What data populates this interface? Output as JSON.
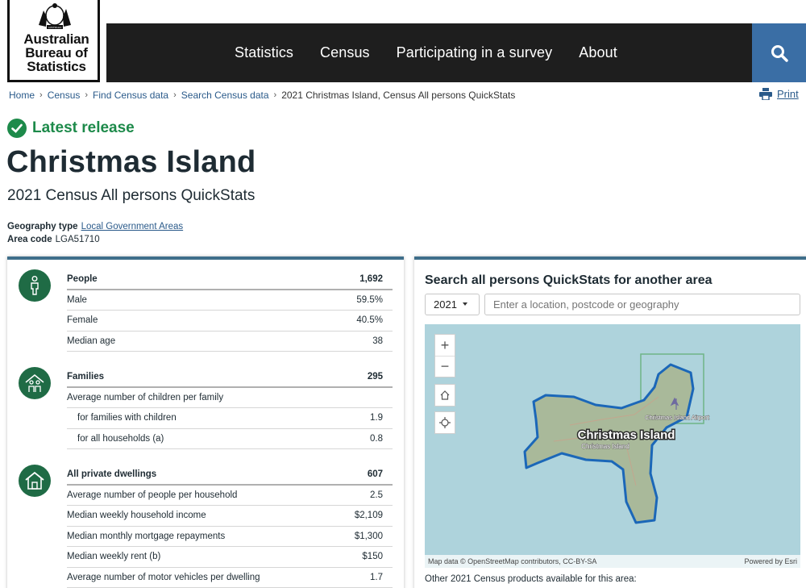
{
  "header": {
    "logo_lines": [
      "Australian",
      "Bureau of",
      "Statistics"
    ],
    "crest_text": "AUSTRALIA",
    "nav": [
      "Statistics",
      "Census",
      "Participating in a survey",
      "About"
    ]
  },
  "breadcrumb": [
    "Home",
    "Census",
    "Find Census data",
    "Search Census data",
    "2021 Christmas Island, Census All persons QuickStats"
  ],
  "print_label": "Print",
  "latest_release": "Latest release",
  "title": "Christmas Island",
  "subtitle": "2021 Census All persons QuickStats",
  "geography": {
    "type_label": "Geography type",
    "type_value": "Local Government Areas",
    "code_label": "Area code",
    "code_value": "LGA51710"
  },
  "stats": {
    "people": [
      {
        "label": "People",
        "value": "1,692"
      },
      {
        "label": "Male",
        "value": "59.5%"
      },
      {
        "label": "Female",
        "value": "40.5%"
      },
      {
        "label": "Median age",
        "value": "38"
      }
    ],
    "families": [
      {
        "label": "Families",
        "value": "295"
      },
      {
        "label": "Average number of children per family",
        "value": ""
      },
      {
        "label": "for families with children",
        "value": "1.9"
      },
      {
        "label": "for all households (a)",
        "value": "0.8"
      }
    ],
    "dwellings": [
      {
        "label": "All private dwellings",
        "value": "607"
      },
      {
        "label": "Average number of people per household",
        "value": "2.5"
      },
      {
        "label": "Median weekly household income",
        "value": "$2,109"
      },
      {
        "label": "Median monthly mortgage repayments",
        "value": "$1,300"
      },
      {
        "label": "Median weekly rent (b)",
        "value": "$150"
      },
      {
        "label": "Average number of motor vehicles per dwelling",
        "value": "1.7"
      }
    ]
  },
  "map_panel": {
    "title": "Search all persons QuickStats for another area",
    "year": "2021",
    "search_placeholder": "Enter a location, postcode or geography",
    "map_label": "Christmas Island",
    "map_sublabel": "Christmas Island",
    "airport_label": "Christmas Island Airport",
    "attribution": "Map data © OpenStreetMap contributors, CC-BY-SA",
    "powered_by": "Powered by Esri",
    "other_products": "Other 2021 Census products available for this area:"
  },
  "colors": {
    "nav_bg": "#1e1e1e",
    "search_bg": "#3a6ea5",
    "accent_green": "#1d8a4a",
    "icon_green": "#1f6b45",
    "map_water": "#aed3dc"
  }
}
